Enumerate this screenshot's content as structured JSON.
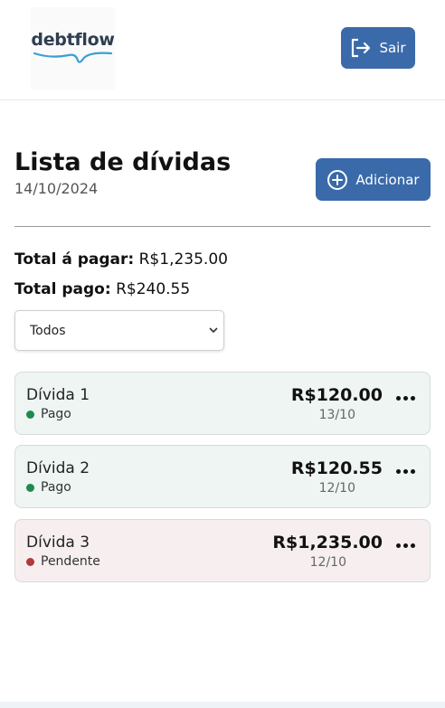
{
  "header": {
    "logo_text": "debtflow",
    "logout_label": "Sair"
  },
  "main": {
    "title": "Lista de dívidas",
    "date": "14/10/2024",
    "add_label": "Adicionar",
    "total_to_pay_label": "Total á pagar:",
    "total_to_pay_value": "R$1,235.00",
    "total_paid_label": "Total pago:",
    "total_paid_value": "R$240.55",
    "filter_selected": "Todos"
  },
  "debts": [
    {
      "name": "Dívida 1",
      "status": "Pago",
      "amount": "R$120.00",
      "due": "13/10"
    },
    {
      "name": "Dívida 2",
      "status": "Pago",
      "amount": "R$120.55",
      "due": "12/10"
    },
    {
      "name": "Dívida 3",
      "status": "Pendente",
      "amount": "R$1,235.00",
      "due": "12/10"
    }
  ],
  "colors": {
    "primary": "#3a6aa9",
    "paid_dot": "#1e8a4e",
    "pending_dot": "#b23a3a",
    "paid_bg": "#eef5f2",
    "pending_bg": "#f7efef"
  }
}
